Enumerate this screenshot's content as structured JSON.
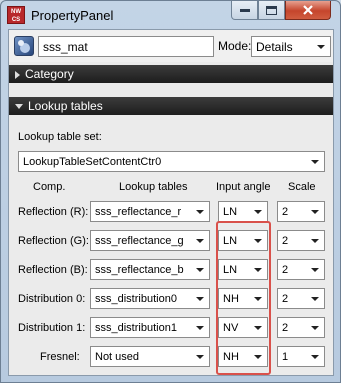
{
  "window": {
    "title": "PropertyPanel",
    "icon_text": "NW CS"
  },
  "toprow": {
    "material_name": "sss_mat",
    "mode_label": "Mode:",
    "mode_value": "Details"
  },
  "sections": {
    "category": "Category",
    "lookup_tables": "Lookup tables"
  },
  "lookup_table_set": {
    "label": "Lookup table set:",
    "value": "LookupTableSetContentCtr0"
  },
  "columns": {
    "comp": "Comp.",
    "tables": "Lookup tables",
    "angle": "Input angle",
    "scale": "Scale"
  },
  "rows": [
    {
      "comp": "Reflection (R):",
      "table": "sss_reflectance_r",
      "angle": "LN",
      "scale": "2"
    },
    {
      "comp": "Reflection (G):",
      "table": "sss_reflectance_g",
      "angle": "LN",
      "scale": "2"
    },
    {
      "comp": "Reflection (B):",
      "table": "sss_reflectance_b",
      "angle": "LN",
      "scale": "2"
    },
    {
      "comp": "Distribution 0:",
      "table": "sss_distribution0",
      "angle": "NH",
      "scale": "2"
    },
    {
      "comp": "Distribution 1:",
      "table": "sss_distribution1",
      "angle": "NV",
      "scale": "2"
    },
    {
      "comp": "Fresnel:",
      "table": "Not used",
      "angle": "NH",
      "scale": "1"
    }
  ],
  "colors": {
    "highlight": "#d9514b",
    "section_bar": "#2a2a2a",
    "title_bar": "#bcd0e5"
  }
}
